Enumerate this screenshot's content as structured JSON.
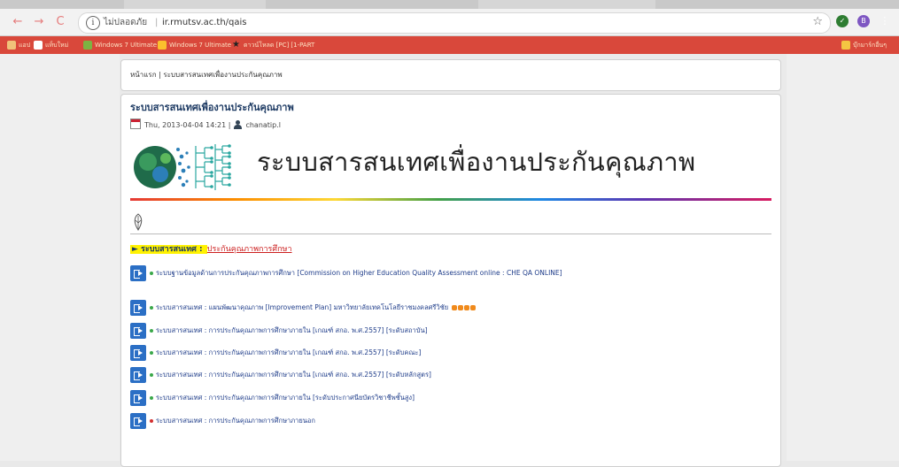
{
  "browser": {
    "security_label": "ไม่ปลอดภัย",
    "url": "ir.rmutsv.ac.th/qais",
    "colors": {
      "chrome": "#d9483b",
      "toolbar": "#f2f2f2"
    },
    "bookmarks": [
      {
        "label": "แอป",
        "icon": "apps-icon"
      },
      {
        "label": "แท็บใหม่",
        "icon": "page-icon"
      },
      {
        "label": "Windows 7 Ultimate",
        "icon": "windows-icon"
      },
      {
        "label": "Windows 7 Ultimate",
        "icon": "windows-icon"
      },
      {
        "label": "ดาวน์โหลด [PC] [1-PART",
        "icon": "star-icon"
      },
      {
        "label": "บุ๊กมาร์กอื่นๆ",
        "icon": "folder-icon"
      }
    ]
  },
  "breadcrumb": {
    "home": "หน้าแรก",
    "separator": "|",
    "current": "ระบบสารสนเทศเพื่องานประกันคุณภาพ"
  },
  "node": {
    "title": "ระบบสารสนเทศเพื่องานประกันคุณภาพ",
    "date": "Thu, 2013-04-04 14:21",
    "meta_separator": "|",
    "author": "chanatip.l"
  },
  "banner": {
    "title": "ระบบสารสนเทศเพื่องานประกันคุณภาพ"
  },
  "section": {
    "prefix": "► ระบบสารสนเทศ : ",
    "link": "ประกันคุณภาพการศึกษา"
  },
  "links": [
    {
      "text": "ระบบฐานข้อมูลด้านการประกันคุณภาพการศึกษา [Commission on Higher Education Quality Assessment online : CHE QA ONLINE]",
      "bullet": "#3aa84a"
    },
    {
      "text": "ระบบสารสนเทศ : แผนพัฒนาคุณภาพ [Improvement Plan] มหาวิทยาลัยเทคโนโลยีราชมงคลศรีวิชัย",
      "bullet": "#3aa84a",
      "badges": true
    },
    {
      "text": "ระบบสารสนเทศ : การประกันคุณภาพการศึกษาภายใน [เกณฑ์ สกอ. พ.ศ.2557] [ระดับสถาบัน]",
      "bullet": "#3aa84a"
    },
    {
      "text": "ระบบสารสนเทศ : การประกันคุณภาพการศึกษาภายใน [เกณฑ์ สกอ. พ.ศ.2557] [ระดับคณะ]",
      "bullet": "#3aa84a"
    },
    {
      "text": "ระบบสารสนเทศ : การประกันคุณภาพการศึกษาภายใน [เกณฑ์ สกอ. พ.ศ.2557] [ระดับหลักสูตร]",
      "bullet": "#3aa84a"
    },
    {
      "text": "ระบบสารสนเทศ : การประกันคุณภาพการศึกษาภายใน [ระดับประกาศนียบัตรวิชาชีพชั้นสูง]",
      "bullet": "#3aa84a"
    },
    {
      "text": "ระบบสารสนเทศ : การประกันคุณภาพการศึกษาภายนอก",
      "bullet": "#d32f2f"
    }
  ]
}
